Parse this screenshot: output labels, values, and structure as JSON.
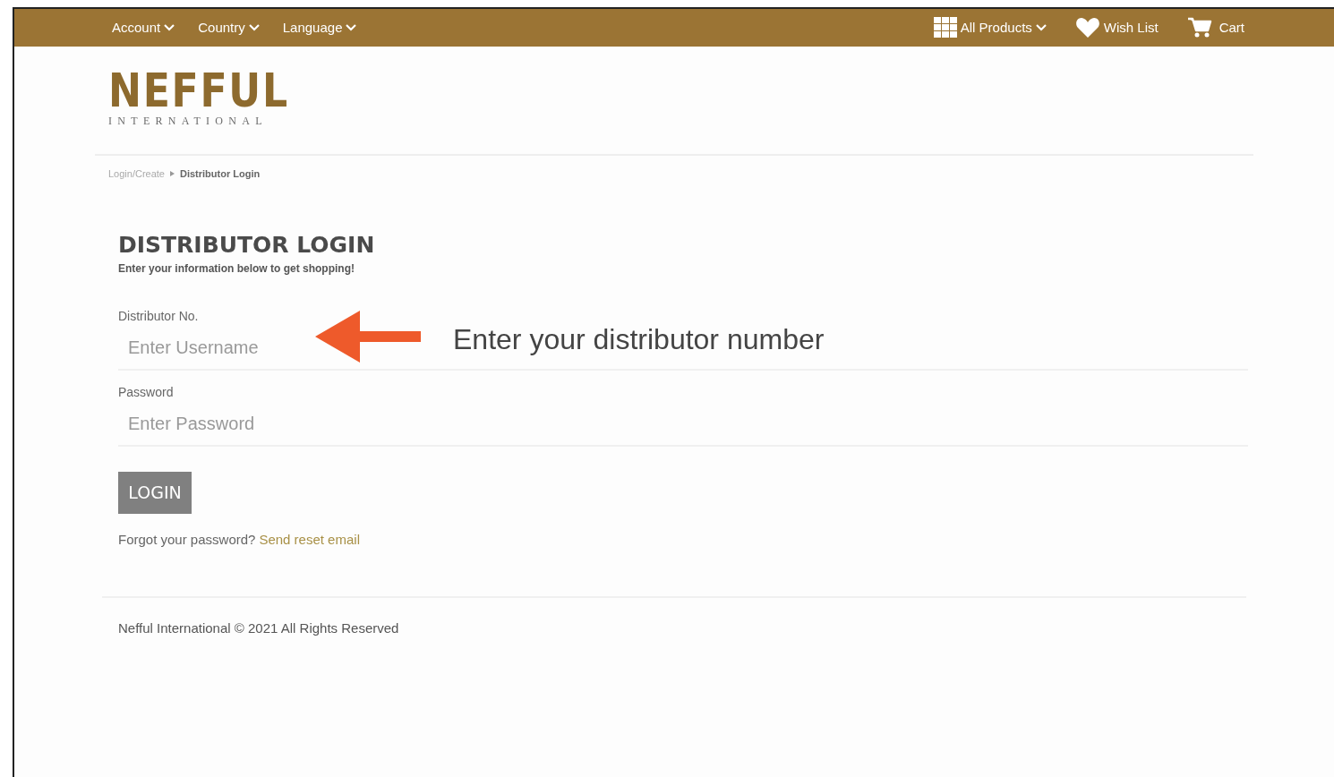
{
  "top_nav": {
    "left": [
      {
        "label": "Account",
        "dropdown": true
      },
      {
        "label": "Country",
        "dropdown": true
      },
      {
        "label": "Language",
        "dropdown": true
      }
    ],
    "right": [
      {
        "kind": "grid",
        "label": "All Products",
        "dropdown": true
      },
      {
        "kind": "heart",
        "label": "Wish List",
        "dropdown": false
      },
      {
        "kind": "cart",
        "label": "Cart",
        "dropdown": false
      }
    ]
  },
  "logo": {
    "name": "NEFFUL",
    "tagline": "INTERNATIONAL"
  },
  "breadcrumb": [
    {
      "label": "Login/Create",
      "current": false
    },
    {
      "label": "Distributor Login",
      "current": true
    }
  ],
  "heading": "DISTRIBUTOR LOGIN",
  "subtitle": "Enter your information below to get shopping!",
  "fields": [
    {
      "label": "Distributor No.",
      "placeholder": "Enter Username"
    },
    {
      "label": "Password",
      "placeholder": "Enter Password"
    }
  ],
  "login_button": "LOGIN",
  "forgot": {
    "text": "Forgot your password?",
    "link": "Send reset email"
  },
  "footer": "Nefful International © 2021 All Rights Reserved",
  "annotation": "Enter your distributor number"
}
